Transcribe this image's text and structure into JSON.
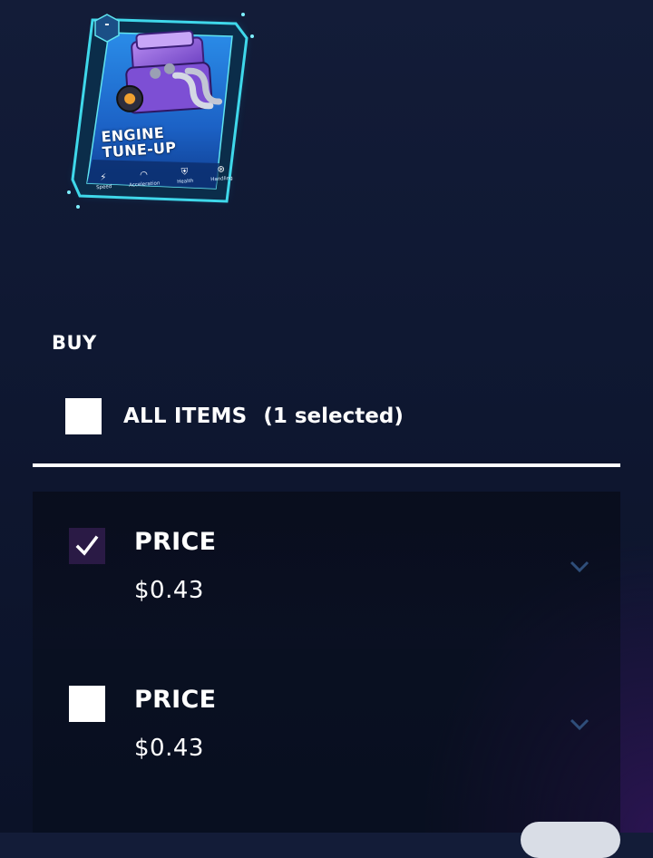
{
  "card": {
    "title_line1": "ENGINE",
    "title_line2": "TUNE-UP",
    "badge": "-",
    "stats": [
      {
        "icon": "bolt-icon",
        "glyph": "⚡",
        "label": "Speed"
      },
      {
        "icon": "gauge-icon",
        "glyph": "◠",
        "label": "Acceleration"
      },
      {
        "icon": "shield-icon",
        "glyph": "⛨",
        "label": "Health"
      },
      {
        "icon": "steering-wheel-icon",
        "glyph": "⊛",
        "label": "Handling"
      }
    ]
  },
  "buy": {
    "title": "BUY",
    "all_items_label": "ALL ITEMS",
    "selected_count": "(1 selected)"
  },
  "listings": [
    {
      "price_label": "PRICE",
      "price_value": "$0.43",
      "checked": true
    },
    {
      "price_label": "PRICE",
      "price_value": "$0.43",
      "checked": false
    }
  ],
  "colors": {
    "background": "#0f1832",
    "card_frame": "#2fd3e6",
    "card_inner": "#1f6fd0",
    "checked_box": "#2a1a45",
    "chevron": "#2f4e7a"
  }
}
